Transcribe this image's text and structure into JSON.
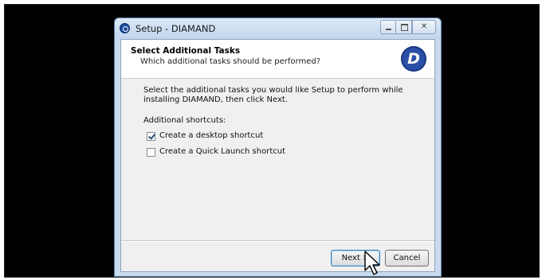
{
  "window": {
    "title": "Setup - DIAMAND",
    "close_glyph": "✕"
  },
  "header": {
    "title": "Select Additional Tasks",
    "subtitle": "Which additional tasks should be performed?",
    "logo_letter": "D"
  },
  "body": {
    "description": "Select the additional tasks you would like Setup to perform while installing DIAMAND, then click Next.",
    "shortcuts_label": "Additional shortcuts:",
    "tasks": [
      {
        "label": "Create a desktop shortcut",
        "checked": true
      },
      {
        "label": "Create a Quick Launch shortcut",
        "checked": false
      }
    ]
  },
  "footer": {
    "next_label": "Next >",
    "cancel_label": "Cancel"
  },
  "colors": {
    "logo": "#2a4fa6",
    "titlebar": "#c9daf0",
    "desktop": "#000000"
  }
}
